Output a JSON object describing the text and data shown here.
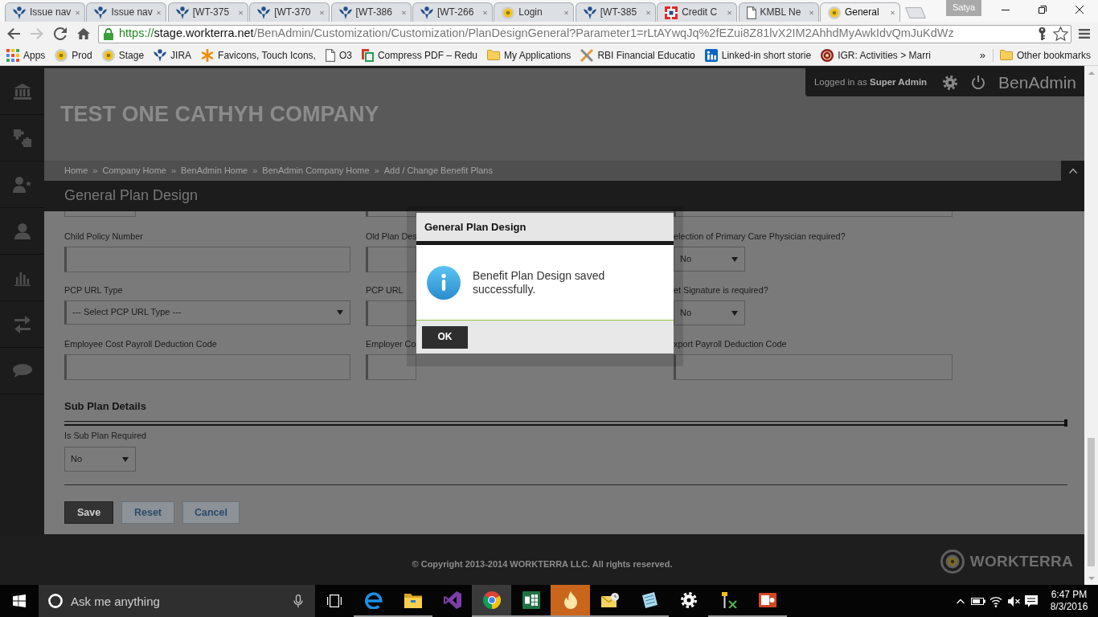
{
  "browser": {
    "tabs": [
      {
        "title": "Issue nav",
        "kind": "jira",
        "selected": false
      },
      {
        "title": "Issue nav",
        "kind": "jira",
        "selected": false
      },
      {
        "title": "[WT-375",
        "kind": "jira",
        "selected": false
      },
      {
        "title": "[WT-370",
        "kind": "jira",
        "selected": false
      },
      {
        "title": "[WT-386",
        "kind": "jira",
        "selected": false
      },
      {
        "title": "[WT-266",
        "kind": "jira",
        "selected": false
      },
      {
        "title": "Login",
        "kind": "seal",
        "selected": false
      },
      {
        "title": "[WT-385",
        "kind": "jira",
        "selected": false
      },
      {
        "title": "Credit C",
        "kind": "bank",
        "selected": false
      },
      {
        "title": "KMBL Ne",
        "kind": "page",
        "selected": false
      },
      {
        "title": "General",
        "kind": "seal",
        "selected": true
      }
    ],
    "profile": "Satya",
    "navigation": [
      {
        "kind": "back",
        "disabled": false
      },
      {
        "kind": "forward",
        "disabled": true
      },
      {
        "kind": "reload",
        "disabled": false
      },
      {
        "kind": "home",
        "disabled": false
      }
    ],
    "address": {
      "scheme": "https://",
      "host": "stage.workterra.net",
      "path": "/BenAdmin/Customization/Customization/PlanDesignGeneral?Parameter1=rLtAYwqJq%2fEZui8Z81lvX2IM2AhhdMyAwkIdvQmJuKdWz"
    },
    "bookmarks": [
      {
        "label": "Apps",
        "kind": "grid"
      },
      {
        "label": "Prod",
        "kind": "seal"
      },
      {
        "label": "Stage",
        "kind": "seal"
      },
      {
        "label": "JIRA",
        "kind": "jira"
      },
      {
        "label": "Favicons, Touch Icons,",
        "kind": "asterisk"
      },
      {
        "label": "O3",
        "kind": "page"
      },
      {
        "label": "Compress PDF – Redu",
        "kind": "compress"
      },
      {
        "label": "My Applications",
        "kind": "folder"
      },
      {
        "label": "RBI Financial Educatio",
        "kind": "tools"
      },
      {
        "label": "Linked-in short storie",
        "kind": "tile"
      },
      {
        "label": "IGR: Activities > Marri",
        "kind": "emblem"
      }
    ],
    "bookmarks_more": "»",
    "other_bookmarks": {
      "label": "Other bookmarks",
      "kind": "folder"
    }
  },
  "app": {
    "login": "Logged in as **Super Admin**",
    "product": "BenAdmin",
    "company": "TEST ONE CATHYH COMPANY",
    "breadcrumbs": [
      {
        "label": "Home",
        "separator": "»"
      },
      {
        "label": "Company Home",
        "separator": "»"
      },
      {
        "label": "BenAdmin Home",
        "separator": "»"
      },
      {
        "label": "BenAdmin Company Home",
        "separator": "»"
      },
      {
        "label": "Add / Change Benefit Plans"
      }
    ],
    "page_title": "General Plan Design"
  },
  "form": {
    "cut_row": [
      {
        "kind": "choice"
      },
      {
        "kind": "input"
      },
      {
        "kind": "input"
      }
    ],
    "rows": [
      [
        {
          "label": "Child Policy Number",
          "kind": "input"
        },
        {
          "label": "Old Plan Des",
          "kind": "input"
        },
        {
          "label": "election of Primary Care Physician required?",
          "kind": "choice",
          "value": "No"
        }
      ],
      [
        {
          "label": "PCP URL Type",
          "kind": "select",
          "value": "--- Select PCP URL Type ---"
        },
        {
          "label": "PCP URL",
          "kind": "input"
        },
        {
          "label": "et Signature is required?",
          "kind": "choice",
          "value": "No"
        }
      ],
      [
        {
          "label": "Employee Cost Payroll Deduction Code",
          "kind": "input"
        },
        {
          "label": "Employer Co",
          "kind": "input"
        },
        {
          "label": "xport Payroll Deduction Code",
          "kind": "input"
        }
      ]
    ],
    "section": "Sub Plan Details",
    "sub_plan": {
      "label": "Is Sub Plan Required",
      "kind": "choice",
      "value": "No"
    },
    "buttons": [
      {
        "label": "Save",
        "kind": "primary"
      },
      {
        "label": "Reset",
        "kind": "secondary"
      },
      {
        "label": "Cancel",
        "kind": "secondary"
      }
    ]
  },
  "modal": {
    "title": "General Plan Design",
    "message": "Benefit Plan Design saved successfully.",
    "button": "OK"
  },
  "footer": {
    "copyright": "© Copyright 2013-2014 WORKTERRA LLC. All rights reserved.",
    "brand": "WORKTERRA"
  },
  "taskbar": {
    "search": {
      "placeholder": "Ask me anything"
    },
    "apps": [
      {
        "kind": "swirl",
        "running": true,
        "selected": false,
        "flashing": false
      },
      {
        "kind": "folder",
        "running": true,
        "selected": false,
        "flashing": false
      },
      {
        "kind": "loop",
        "running": false,
        "selected": false,
        "flashing": false
      },
      {
        "kind": "wheel",
        "running": true,
        "selected": true,
        "flashing": false
      },
      {
        "kind": "sheet",
        "running": true,
        "selected": false,
        "flashing": false
      },
      {
        "kind": "flame",
        "running": true,
        "selected": false,
        "flashing": true
      },
      {
        "kind": "mail",
        "running": true,
        "selected": false,
        "flashing": false
      },
      {
        "kind": "notebook",
        "running": true,
        "selected": false,
        "flashing": false
      },
      {
        "kind": "gear",
        "running": false,
        "selected": false,
        "flashing": false
      },
      {
        "kind": "tools",
        "running": true,
        "selected": false,
        "flashing": false
      },
      {
        "kind": "slides",
        "running": true,
        "selected": false,
        "flashing": false
      }
    ],
    "clock": {
      "time": "6:47 PM",
      "date": "8/3/2016"
    }
  }
}
